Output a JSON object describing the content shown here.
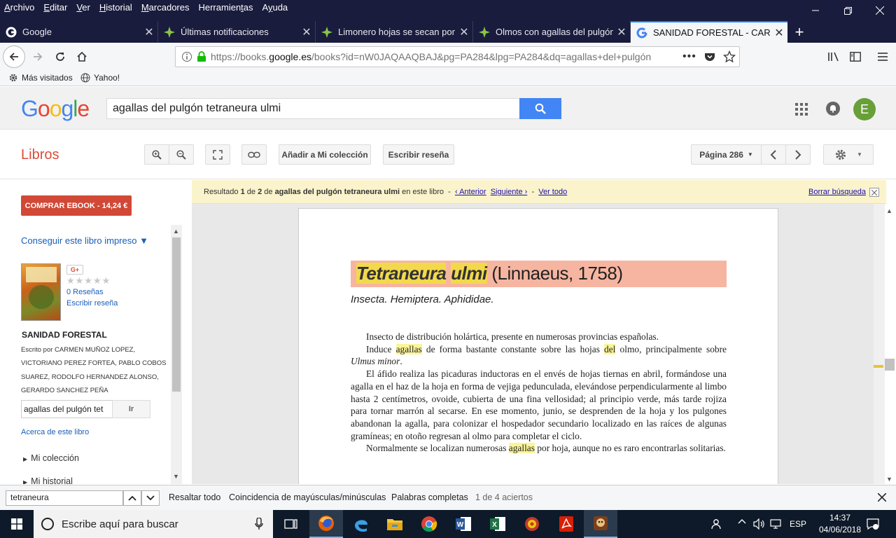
{
  "menu": [
    "Archivo",
    "Editar",
    "Ver",
    "Historial",
    "Marcadores",
    "Herramientas",
    "Ayuda"
  ],
  "menu_accel": [
    "A",
    "E",
    "V",
    "H",
    "M",
    "t",
    "y"
  ],
  "tabs": [
    {
      "title": "Google",
      "icon": "google-favicon"
    },
    {
      "title": "Últimas notificaciones",
      "icon": "green-star-favicon"
    },
    {
      "title": "Limonero hojas se secan por lo",
      "icon": "green-star-favicon"
    },
    {
      "title": "Olmos con agallas del pulgón t",
      "icon": "green-star-favicon"
    },
    {
      "title": "SANIDAD FORESTAL - CARMEN",
      "icon": "google-favicon",
      "active": true
    }
  ],
  "url": {
    "prefix": "https://books.",
    "domain": "google.es",
    "suffix": "/books?id=nW0JAQAAQBAJ&pg=PA284&lpg=PA284&dq=agallas+del+pulgón"
  },
  "bookmarks": [
    {
      "label": "Más visitados"
    },
    {
      "label": "Yahoo!"
    }
  ],
  "google": {
    "logo": [
      "G",
      "o",
      "o",
      "g",
      "l",
      "e"
    ],
    "logo_colors": [
      "#4285f4",
      "#ea4335",
      "#fbbc05",
      "#4285f4",
      "#34a853",
      "#ea4335"
    ],
    "query": "agallas del pulgón tetraneura ulmi",
    "avatar_letter": "E"
  },
  "libros": {
    "title": "Libros",
    "add_collection": "Añadir a Mi colección",
    "write_review": "Escribir reseña",
    "page_select": "Página 286"
  },
  "sidebar": {
    "buy": "COMPRAR EBOOK - 14,24 €",
    "get_print": "Conseguir este libro impreso ▼",
    "gplus": "G+",
    "stars": "★★★★★",
    "reviews": "0 Reseñas",
    "write_review": "Escribir reseña",
    "book_title": "SANIDAD FORESTAL",
    "authors": "Escrito por CARMEN MUÑOZ LOPEZ, VICTORIANO PEREZ FORTEA, PABLO COBOS SUAREZ, RODOLFO HERNANDEZ ALONSO, GERARDO SANCHEZ PEÑA",
    "search_value": "agallas del pulgón tet",
    "go": "Ir",
    "about": "Acerca de este libro",
    "my_collection": "Mi colección",
    "my_history": "Mi historial"
  },
  "resultbar": {
    "pre": "Resultado ",
    "index": "1",
    "mid": " de ",
    "total": "2",
    "mid2": " de ",
    "query": "agallas del pulgón tetraneura ulmi",
    "post": " en este libro",
    "prev": "‹ Anterior",
    "next": "Siguiente ›",
    "all": "Ver todo",
    "clear": "Borrar búsqueda",
    "sep": "-"
  },
  "page": {
    "species": [
      "Tetraneura",
      "ulmi"
    ],
    "authority": "(Linnaeus, 1758)",
    "subtitle": "Insecta. Hemiptera. Aphididae.",
    "p1": "Insecto de distribución holártica, presente en numerosas provincias españolas.",
    "p2a": "Induce ",
    "p2_hl1": "agallas",
    "p2b": " de forma bastante constante sobre las hojas ",
    "p2_hl2": "del",
    "p2c": " olmo, principalmente sobre ",
    "p2_it": "Ulmus minor",
    "p2d": ".",
    "p3": "El áfido realiza las picaduras inductoras en el envés de hojas tiernas en abril, formándose una agalla en el haz de la hoja en forma de vejiga pedunculada, elevándose perpendicularmente al limbo hasta 2 centímetros, ovoide, cubierta de una fina vellosidad; al principio verde, más tarde rojiza para tornar marrón al secarse. En ese momento, junio, se desprenden de la hoja y los pulgones abandonan la agalla, para colonizar el hospedador secundario localizado en las raíces de algunas gramíneas; en otoño regresan al olmo para completar el ciclo.",
    "p4a": "Normalmente se localizan numerosas ",
    "p4_hl": "agallas",
    "p4b": " por hoja, aunque no es raro encontrarlas solitarias."
  },
  "findbar": {
    "value": "tetraneura",
    "highlight_all": "Resaltar todo",
    "match_case": "Coincidencia de mayúsculas/minúsculas",
    "whole_words": "Palabras completas",
    "status": "1 de 4 aciertos"
  },
  "taskbar": {
    "search_placeholder": "Escribe aquí para buscar",
    "lang": "ESP",
    "time": "14:37",
    "date": "04/06/2018",
    "apps": [
      "firefox-icon",
      "edge-icon",
      "file-explorer-icon",
      "chrome-icon",
      "word-icon",
      "excel-icon",
      "media-icon",
      "acrobat-icon",
      "game-icon"
    ]
  },
  "colors": {
    "accent": "#4285f4",
    "libros_red": "#dd4b39",
    "buy_red": "#d14836",
    "result_yellow": "#fbf3cc",
    "title_band": "#f6b5a0"
  }
}
